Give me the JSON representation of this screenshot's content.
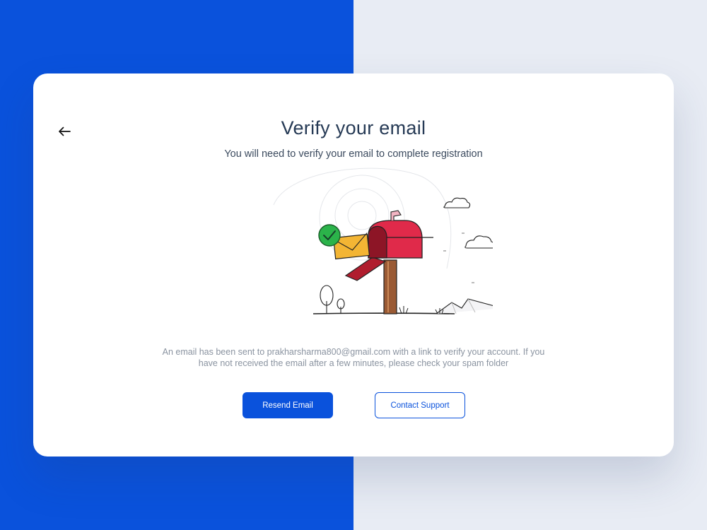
{
  "colors": {
    "accent": "#0a52dc",
    "left_background": "#0a52dc",
    "right_background": "#e8ecf4",
    "title_text": "#263a55",
    "body_text": "#8a93a0"
  },
  "header": {
    "back_icon": "arrow-left-icon",
    "title": "Verify your email",
    "subtitle": "You will need to verify your email to complete registration"
  },
  "illustration": {
    "subject": "mailbox-with-envelope-and-checkmark"
  },
  "message": {
    "text": "An email has been sent to prakharsharma800@gmail.com with a link to verify your account. If you have not received the email after a few minutes, please check your spam folder"
  },
  "actions": {
    "resend_label": "Resend Email",
    "support_label": "Contact Support"
  }
}
